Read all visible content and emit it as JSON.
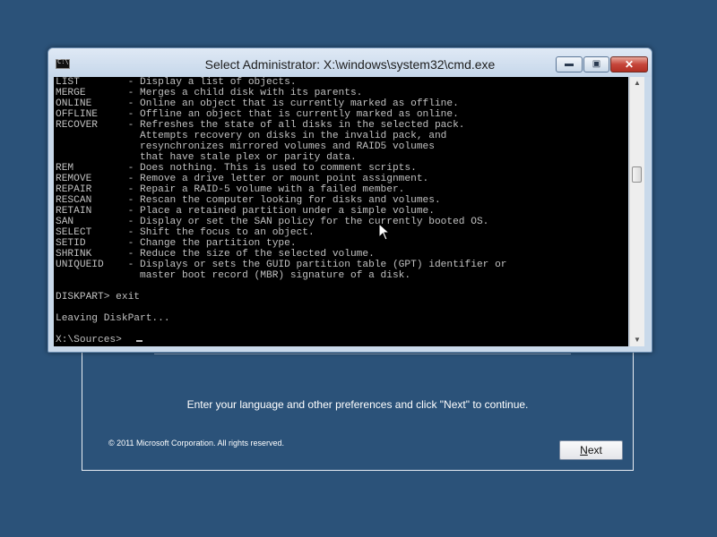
{
  "setup": {
    "instruction": "Enter your language and other preferences and click \"Next\" to continue.",
    "copyright": "© 2011 Microsoft Corporation. All rights reserved.",
    "next_prefix": "",
    "next_accel": "N",
    "next_suffix": "ext"
  },
  "cmd": {
    "title": "Select Administrator: X:\\windows\\system32\\cmd.exe",
    "icon_text": "C:\\",
    "minimize_glyph": "▬",
    "maximize_glyph": "▣",
    "close_glyph": "✕",
    "scroll_up_glyph": "▲",
    "scroll_down_glyph": "▼",
    "console_text": "LIST        - Display a list of objects.\nMERGE       - Merges a child disk with its parents.\nONLINE      - Online an object that is currently marked as offline.\nOFFLINE     - Offline an object that is currently marked as online.\nRECOVER     - Refreshes the state of all disks in the selected pack.\n              Attempts recovery on disks in the invalid pack, and\n              resynchronizes mirrored volumes and RAID5 volumes\n              that have stale plex or parity data.\nREM         - Does nothing. This is used to comment scripts.\nREMOVE      - Remove a drive letter or mount point assignment.\nREPAIR      - Repair a RAID-5 volume with a failed member.\nRESCAN      - Rescan the computer looking for disks and volumes.\nRETAIN      - Place a retained partition under a simple volume.\nSAN         - Display or set the SAN policy for the currently booted OS.\nSELECT      - Shift the focus to an object.\nSETID       - Change the partition type.\nSHRINK      - Reduce the size of the selected volume.\nUNIQUEID    - Displays or sets the GUID partition table (GPT) identifier or\n              master boot record (MBR) signature of a disk.\n\nDISKPART> exit\n\nLeaving DiskPart...\n\nX:\\Sources>"
  }
}
